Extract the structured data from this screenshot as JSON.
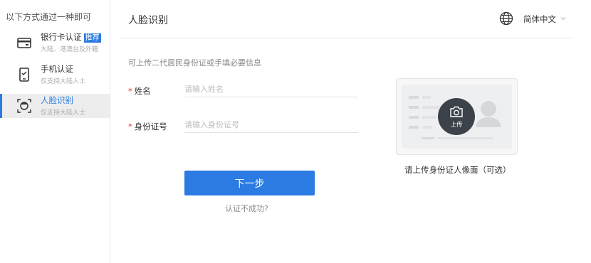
{
  "sidebar": {
    "title": "以下方式通过一种即可",
    "items": [
      {
        "label": "银行卡认证",
        "tag": "推荐",
        "sub": "大陆、港澳台及外籍",
        "icon": "bank-card-icon"
      },
      {
        "label": "手机认证",
        "sub": "仅支持大陆人士",
        "icon": "mobile-phone-icon"
      },
      {
        "label": "人脸识别",
        "sub": "仅支持大陆人士",
        "icon": "face-scan-icon",
        "active": true
      }
    ]
  },
  "header": {
    "title": "人脸识别",
    "language": "简体中文"
  },
  "form": {
    "hint": "可上传二代居民身份证或手填必要信息",
    "required_mark": "*",
    "name_label": "姓名",
    "name_placeholder": "请输入姓名",
    "id_label": "身份证号",
    "id_placeholder": "请输入身份证号",
    "next_label": "下一步",
    "fail_link": "认证不成功?"
  },
  "upload": {
    "button_label": "上传",
    "caption": "请上传身份证人像面（可选）"
  },
  "colors": {
    "accent": "#2b7be2",
    "required": "#e53935",
    "upload_button": "#3d424a"
  }
}
